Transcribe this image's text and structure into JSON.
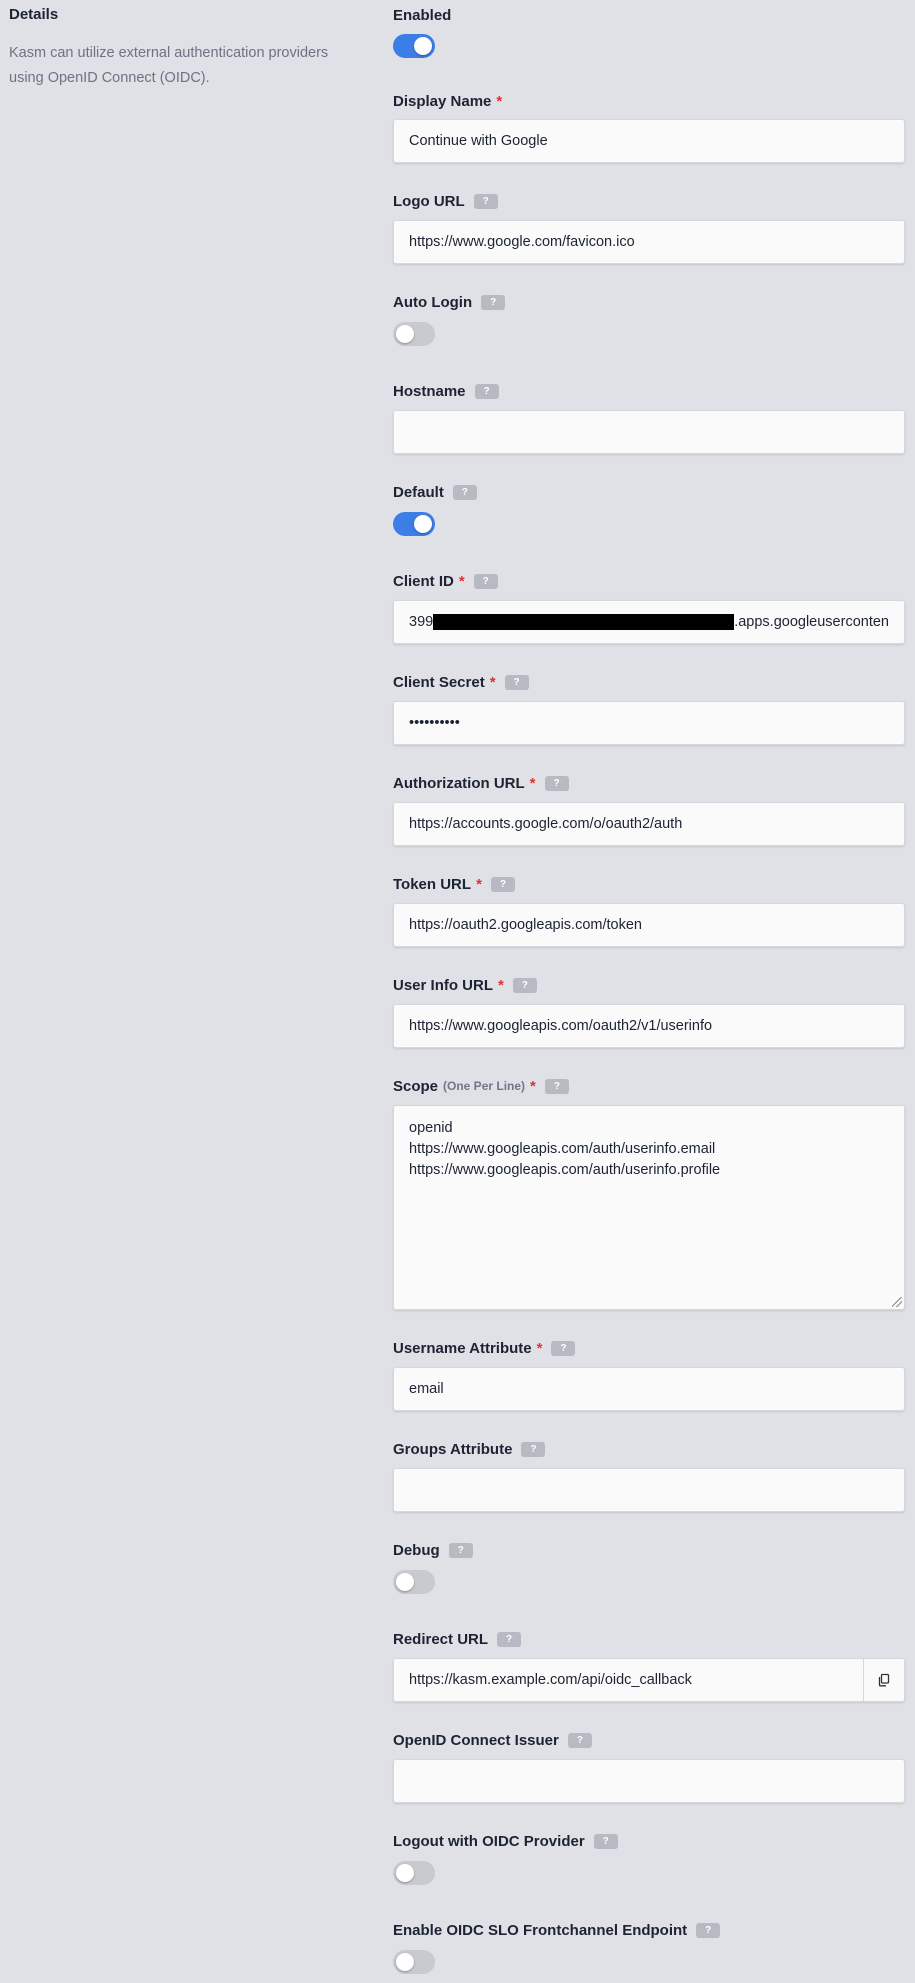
{
  "details": {
    "title": "Details",
    "description": "Kasm can utilize external authentication providers using OpenID Connect (OIDC)."
  },
  "help_glyph": "?",
  "required_mark": "*",
  "fields": {
    "enabled": {
      "label": "Enabled",
      "value": true
    },
    "display_name": {
      "label": "Display Name",
      "value": "Continue with Google"
    },
    "logo_url": {
      "label": "Logo URL",
      "value": "https://www.google.com/favicon.ico"
    },
    "auto_login": {
      "label": "Auto Login",
      "value": false
    },
    "hostname": {
      "label": "Hostname",
      "value": ""
    },
    "default": {
      "label": "Default",
      "value": true
    },
    "client_id": {
      "label": "Client ID",
      "value_prefix": "399",
      "value_suffix": ".apps.googleuserconten"
    },
    "client_secret": {
      "label": "Client Secret",
      "value": "••••••••••"
    },
    "authorization_url": {
      "label": "Authorization URL",
      "value": "https://accounts.google.com/o/oauth2/auth"
    },
    "token_url": {
      "label": "Token URL",
      "value": "https://oauth2.googleapis.com/token"
    },
    "user_info_url": {
      "label": "User Info URL",
      "value": "https://www.googleapis.com/oauth2/v1/userinfo"
    },
    "scope": {
      "label": "Scope",
      "sublabel": "(One Per Line)",
      "lines": [
        "openid",
        "https://www.googleapis.com/auth/userinfo.email",
        "https://www.googleapis.com/auth/userinfo.profile"
      ]
    },
    "username_attribute": {
      "label": "Username Attribute",
      "value": "email"
    },
    "groups_attribute": {
      "label": "Groups Attribute",
      "value": ""
    },
    "debug": {
      "label": "Debug",
      "value": false
    },
    "redirect_url": {
      "label": "Redirect URL",
      "value": "https://kasm.example.com/api/oidc_callback",
      "icon": "copy-icon"
    },
    "oidc_issuer": {
      "label": "OpenID Connect Issuer",
      "value": ""
    },
    "logout_oidc": {
      "label": "Logout with OIDC Provider",
      "value": false
    },
    "slo_frontchannel": {
      "label": "Enable OIDC SLO Frontchannel Endpoint",
      "value": false
    }
  },
  "colors": {
    "background": "#dfe1e7",
    "toggle_on": "#3d7ee6",
    "toggle_off": "#c8cad0",
    "required": "#dd3333"
  }
}
